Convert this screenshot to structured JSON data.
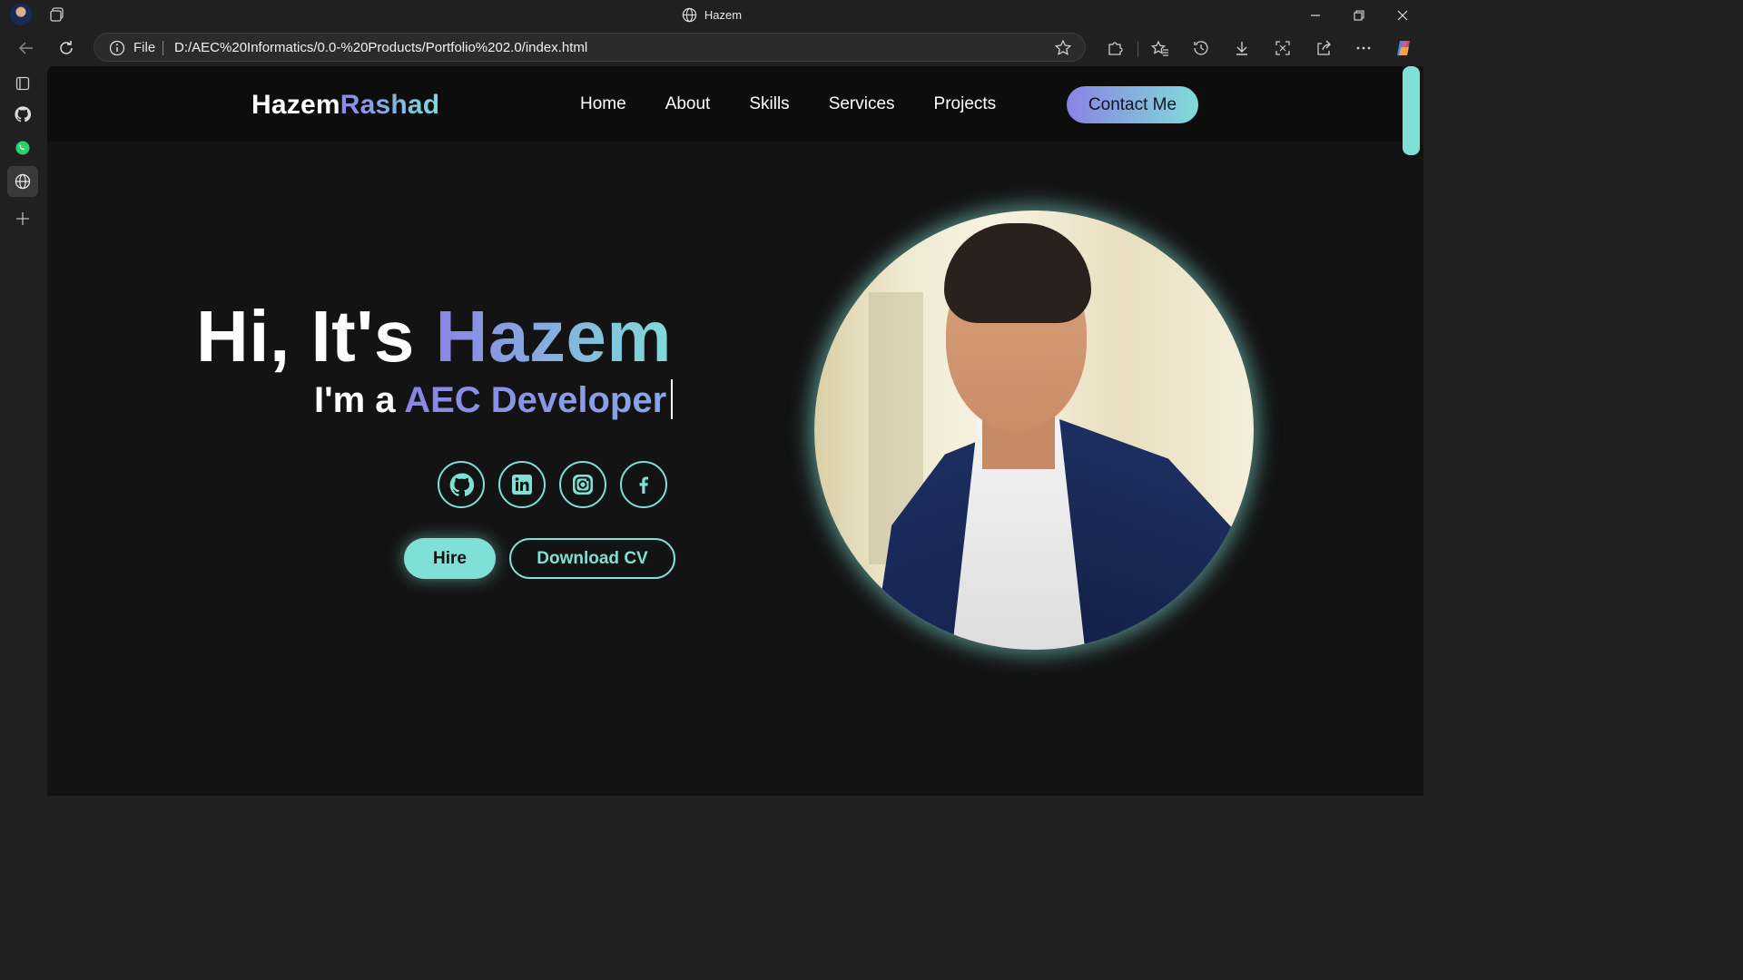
{
  "browser": {
    "window_title": "Hazem",
    "address": {
      "scheme_label": "File",
      "url": "D:/AEC%20Informatics/0.0-%20Products/Portfolio%202.0/index.html"
    }
  },
  "site": {
    "logo_part1": "Hazem",
    "logo_part2": "Rashad",
    "nav": [
      "Home",
      "About",
      "Skills",
      "Services",
      "Projects"
    ],
    "contact_label": "Contact Me",
    "hero": {
      "greeting": "Hi, It's ",
      "name": "Hazem",
      "prefix": "I'm a ",
      "role": "AEC Developer"
    },
    "socials": [
      "github-icon",
      "linkedin-icon",
      "instagram-icon",
      "facebook-icon"
    ],
    "hire_label": "Hire",
    "cv_label": "Download CV"
  },
  "colors": {
    "accent": "#7fe0d6",
    "gradient_start": "#8b84e6",
    "background": "#131313"
  }
}
